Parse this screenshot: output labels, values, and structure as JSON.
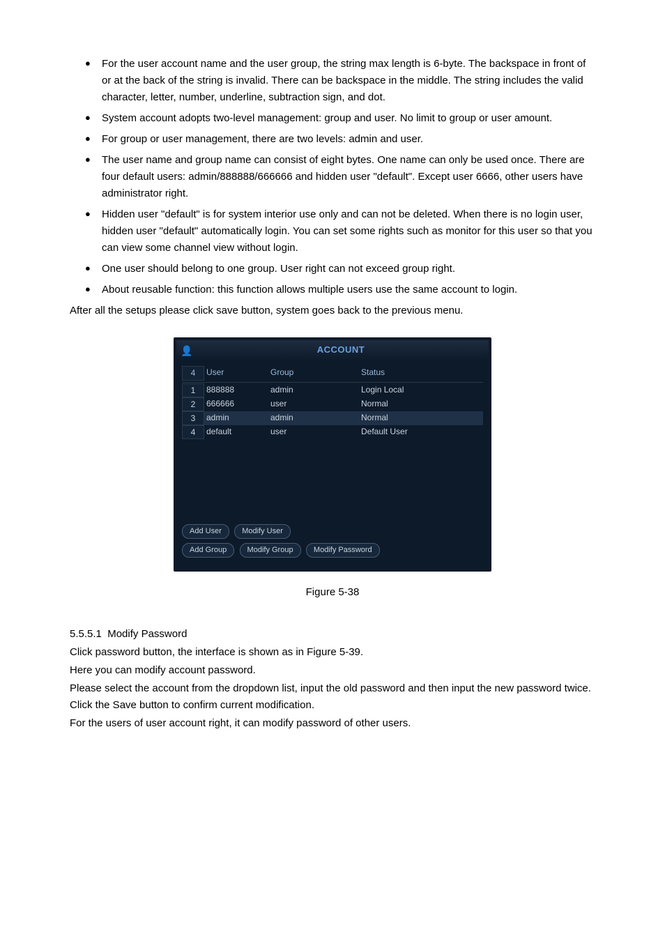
{
  "bullets": [
    "For the user account name and the user group, the string max length is 6-byte. The backspace in front of or at the back of the string is invalid. There can be backspace in the middle. The string includes the valid character, letter, number, underline, subtraction sign, and dot.",
    "System account adopts two-level management: group and user. No limit to group or user amount.",
    "For group or user management, there are two levels: admin and user.",
    "The user name and group name can consist of eight bytes. One name can only be used once. There are four default users: admin/888888/666666 and hidden user \"default\". Except user 6666, other users have administrator right.",
    "Hidden user \"default\" is for system interior use only and can not be deleted. When there is no login user, hidden user \"default\" automatically login. You can set some rights such as monitor for this user so that you can view some channel view without login.",
    "One user should belong to one group. User right can not exceed group right.",
    "About reusable function: this function allows multiple users use the same account to login."
  ],
  "after_text": "After all the setups please click save button, system goes back to the previous menu.",
  "window": {
    "title": "ACCOUNT",
    "count_header": "4",
    "columns": {
      "user": "User",
      "group": "Group",
      "status": "Status"
    },
    "rows": [
      {
        "idx": "1",
        "user": "888888",
        "group": "admin",
        "status": "Login Local"
      },
      {
        "idx": "2",
        "user": "666666",
        "group": "user",
        "status": "Normal"
      },
      {
        "idx": "3",
        "user": "admin",
        "group": "admin",
        "status": "Normal"
      },
      {
        "idx": "4",
        "user": "default",
        "group": "user",
        "status": "Default User"
      }
    ],
    "buttons": {
      "add_user": "Add User",
      "modify_user": "Modify User",
      "add_group": "Add Group",
      "modify_group": "Modify Group",
      "modify_password": "Modify Password"
    }
  },
  "figure_caption": "Figure 5-38",
  "section": {
    "number": "5.5.5.1",
    "title": "Modify Password",
    "lines": [
      "Click password button, the interface is shown as in Figure 5-39.",
      "Here you can modify account password.",
      "Please select the account from the dropdown list, input the old password and then input the new password twice. Click the Save button to confirm current modification.",
      "For the users of user account right, it can modify password of other users."
    ]
  }
}
